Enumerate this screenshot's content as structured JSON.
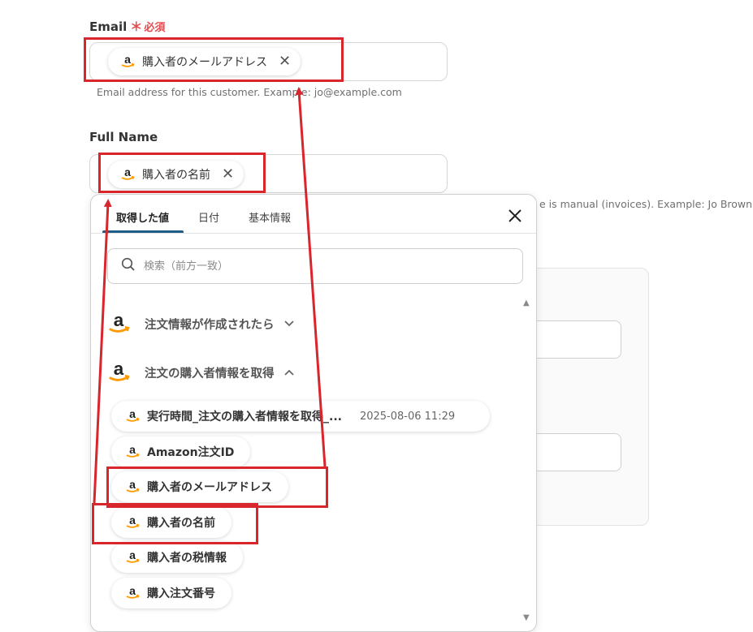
{
  "email": {
    "label": "Email",
    "required_mark": "＊",
    "required_text": "必須",
    "chip_label": "購入者のメールアドレス",
    "help": "Email address for this customer. Example: jo@example.com"
  },
  "fullname": {
    "label": "Full Name",
    "chip_label": "購入者の名前",
    "help_tail": "e is manual (invoices). Example: Jo Brown"
  },
  "popup": {
    "tabs": [
      {
        "label": "取得した値"
      },
      {
        "label": "日付"
      },
      {
        "label": "基本情報"
      }
    ],
    "search_placeholder": "検索（前方一致）",
    "groups": [
      {
        "label": "注文情報が作成されたら",
        "chevron": "down"
      },
      {
        "label": "注文の購入者情報を取得",
        "chevron": "up"
      }
    ],
    "items": [
      {
        "label": "実行時間_注文の購入者情報を取得_...",
        "timestamp": "2025-08-06 11:29"
      },
      {
        "label": "Amazon注文ID"
      },
      {
        "label": "購入者のメールアドレス"
      },
      {
        "label": "購入者の名前"
      },
      {
        "label": "購入者の税情報"
      },
      {
        "label": "購入注文番号"
      }
    ]
  },
  "colors": {
    "annotation_red": "#d9262c",
    "required_red": "#e5484d",
    "tab_accent": "#1f5d86",
    "amazon_orange": "#ff9900"
  },
  "icons": {
    "amazon": "amazon-logo-icon",
    "remove": "close-x-icon",
    "close": "close-icon",
    "search": "search-icon",
    "chevron_down": "chevron-down-icon",
    "chevron_up": "chevron-up-icon"
  }
}
